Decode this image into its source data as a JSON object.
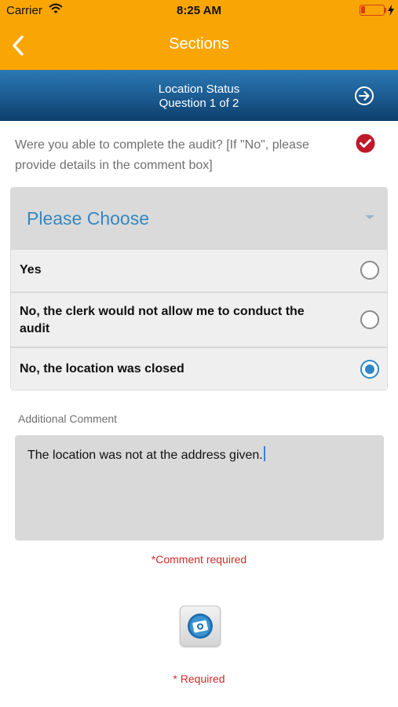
{
  "status_bar": {
    "carrier": "Carrier",
    "time": "8:25 AM"
  },
  "nav": {
    "title": "Sections",
    "back_icon": "chevron-left-icon"
  },
  "question_header": {
    "section": "Location Status",
    "counter": "Question 1 of 2",
    "next_icon": "arrow-right-circle-icon"
  },
  "question": {
    "text": "Were you able to complete the audit? [If \"No\", please provide details in the comment box]",
    "status_icon": "check-circle-icon"
  },
  "choices": {
    "placeholder": "Please Choose",
    "options": [
      {
        "label": "Yes",
        "selected": false
      },
      {
        "label": "No, the clerk would not allow me to conduct the audit",
        "selected": false
      },
      {
        "label": "No, the location was closed",
        "selected": true
      }
    ]
  },
  "comment": {
    "label": "Additional Comment",
    "value": "The location was not at the address given.",
    "required_note": "*Comment required"
  },
  "footer": {
    "camera_icon": "camera-icon",
    "required_note": "* Required"
  },
  "colors": {
    "accent": "#f9a504",
    "header_blue": "#1b5a8f",
    "link_blue": "#3588c0",
    "error_red": "#d12a2a",
    "check_red": "#c0182b"
  }
}
